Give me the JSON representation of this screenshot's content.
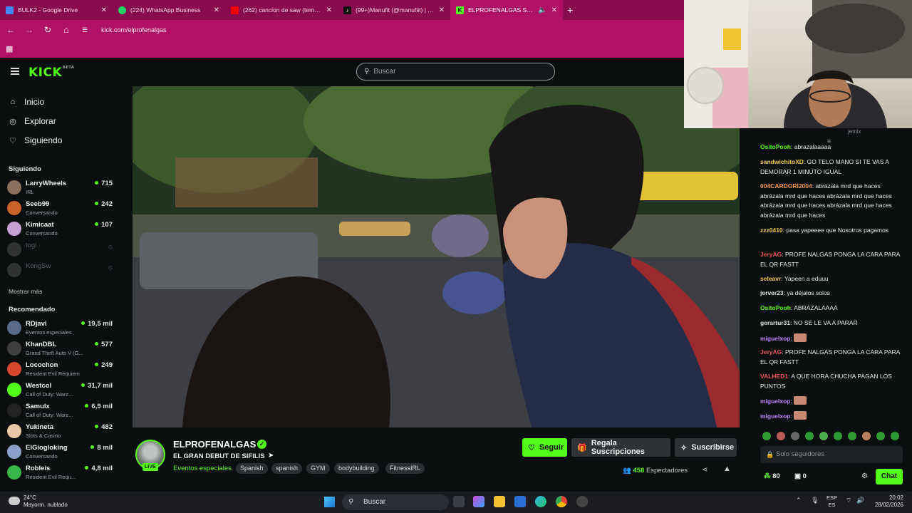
{
  "browser": {
    "tabs": [
      {
        "label": "BULK2 - Google Drive",
        "color": "#4285f4"
      },
      {
        "label": "(224) WhatsApp Business",
        "color": "#25d366"
      },
      {
        "label": "(262) cancion de saw (tema orig...",
        "color": "#ff0000"
      },
      {
        "label": "(99+)Manufit (@manufiit) | Tik...",
        "color": "#111111"
      },
      {
        "label": "ELPROFENALGAS Stream - ...",
        "color": "#53fc18"
      }
    ],
    "url": "kick.com/elprofenalgas"
  },
  "header": {
    "logo": "KICK",
    "logo_badge": "BETA",
    "search_placeholder": "Buscar"
  },
  "sidebar": {
    "nav": [
      {
        "label": "Inicio",
        "icon": "home-icon"
      },
      {
        "label": "Explorar",
        "icon": "compass-icon"
      },
      {
        "label": "Siguiendo",
        "icon": "heart-icon"
      }
    ],
    "following_title": "Siguiendo",
    "following": [
      {
        "name": "LarryWheels",
        "sub": "IRL",
        "viewers": "715",
        "color": "#8b6f5e"
      },
      {
        "name": "Seeb99",
        "sub": "Conversando",
        "viewers": "242",
        "color": "#c8622a"
      },
      {
        "name": "Kimicaat",
        "sub": "Conversando",
        "viewers": "107",
        "color": "#c7a1d4"
      },
      {
        "name": "togi",
        "sub": "",
        "viewers": "",
        "color": "#777777"
      },
      {
        "name": "KongSw",
        "sub": "",
        "viewers": "",
        "color": "#777777"
      }
    ],
    "show_more": "Mostrar más",
    "recommended_title": "Recomendado",
    "recommended": [
      {
        "name": "RDjavi",
        "sub": "Eventos especiales",
        "viewers": "19,5 mil",
        "color": "#5a6b8a"
      },
      {
        "name": "KhanDBL",
        "sub": "Grand Theft Auto V (G...",
        "viewers": "577",
        "color": "#3f3f3f"
      },
      {
        "name": "Locochon",
        "sub": "Resident Evil Requiem",
        "viewers": "249",
        "color": "#d8472f"
      },
      {
        "name": "Westcol",
        "sub": "Call of Duty: Warz...",
        "viewers": "31,7 mil",
        "color": "#53fc18"
      },
      {
        "name": "Samulx",
        "sub": "Call of Duty: Warz...",
        "viewers": "6,9 mil",
        "color": "#222222"
      },
      {
        "name": "Yukineta",
        "sub": "Slots & Casino",
        "viewers": "482",
        "color": "#e9c7a6"
      },
      {
        "name": "ElGiogloking",
        "sub": "Conversando",
        "viewers": "8 mil",
        "color": "#8aa0c9"
      },
      {
        "name": "Robleis",
        "sub": "Resident Evil Requ...",
        "viewers": "4,8 mil",
        "color": "#39b54a"
      }
    ]
  },
  "stream": {
    "channel": "ELPROFENALGAS",
    "live_badge": "LIVE",
    "title": "EL GRAN DEBUT DE SIFILIS",
    "category": "Eventos especiales",
    "tags": [
      "Spanish",
      "spanish",
      "GYM",
      "bodybuilding",
      "FitnessIRL"
    ],
    "follow_label": "Seguir",
    "gift_label": "Regala Suscripciones",
    "subscribe_label": "Suscribirse",
    "viewers_count": "458",
    "viewers_label": "Espectadores"
  },
  "chat": {
    "messages": [
      {
        "user": "OsitoPooh",
        "color": "#53fc18",
        "text": "abrazalaaaaa"
      },
      {
        "user": "sandwichitoXD",
        "color": "#f2c94c",
        "text": "GO TELO MANO SI TE VAS A DEMORAR 1 MINUTO IGUAL"
      },
      {
        "user": "004CARDORI2004",
        "color": "#f2994a",
        "text": "abrázala mrd que haces abrázala mrd que haces abrázala mrd que haces abrázala mrd que haces abrázala mrd que haces abrázala mrd que haces"
      },
      {
        "user": "zzz0410",
        "color": "#f2c94c",
        "text": "pasa yapeeee que Nosotros pagamos"
      },
      {
        "user": "JeryAG",
        "color": "#eb5757",
        "text": "PROFE NALGAS PONGA LA CARA PARA EL QR FASTT"
      },
      {
        "user": "seleavr",
        "color": "#f2c94c",
        "text": "Yapeen a eduuu"
      },
      {
        "user": "jerver23",
        "color": "#e0e0e0",
        "text": "ya déjalos solos"
      },
      {
        "user": "OsitoPooh",
        "color": "#53fc18",
        "text": "ABRAZALAAAA"
      },
      {
        "user": "gerartur31",
        "color": "#e0e0e0",
        "text": "NO SE LE VA A PARAR"
      },
      {
        "user": "miguelxop",
        "color": "#bb86fc",
        "text": ""
      },
      {
        "user": "JeryAG",
        "color": "#eb5757",
        "text": "PROFE NALGAS PONGA LA CARA PARA EL QR FASTT"
      },
      {
        "user": "VALHED1",
        "color": "#eb5757",
        "text": "A QUE HORA CHUCHA PAGAN LOS PUNTOS"
      },
      {
        "user": "miguelxop",
        "color": "#bb86fc",
        "text": ""
      },
      {
        "user": "miguelxop",
        "color": "#bb86fc",
        "text": ""
      }
    ],
    "input_placeholder": "Solo seguidores",
    "points": "80",
    "gifts": "0",
    "chat_button": "Chat",
    "top_user": "jemix"
  },
  "taskbar": {
    "temperature": "24°C",
    "weather": "Mayorm. nublado",
    "search": "Buscar",
    "lang1": "ESP",
    "lang2": "ES",
    "time": "20:02",
    "date": "28/02/2026"
  }
}
